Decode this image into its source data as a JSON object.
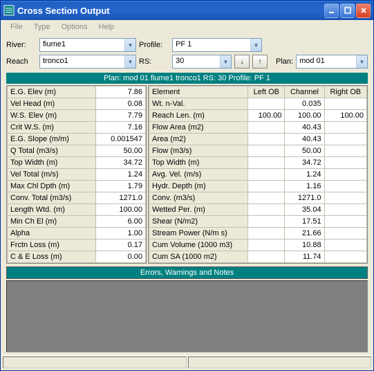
{
  "window": {
    "title": "Cross Section Output"
  },
  "menu": {
    "file": "File",
    "type": "Type",
    "options": "Options",
    "help": "Help"
  },
  "controls": {
    "river_label": "River:",
    "river_value": "fiume1",
    "profile_label": "Profile:",
    "profile_value": "PF 1",
    "reach_label": "Reach",
    "reach_value": "tronco1",
    "rs_label": "RS:",
    "rs_value": "30",
    "plan_label": "Plan:",
    "plan_value": "mod 01"
  },
  "planbar": "Plan: mod 01    fiume1    tronco1   RS: 30    Profile: PF 1",
  "left_rows": [
    {
      "l": "E.G. Elev (m)",
      "v": "7.86"
    },
    {
      "l": "Vel Head (m)",
      "v": "0.08"
    },
    {
      "l": "W.S. Elev (m)",
      "v": "7.79"
    },
    {
      "l": "Crit W.S. (m)",
      "v": "7.16"
    },
    {
      "l": "E.G. Slope (m/m)",
      "v": "0.001547"
    },
    {
      "l": "Q Total (m3/s)",
      "v": "50.00"
    },
    {
      "l": "Top Width (m)",
      "v": "34.72"
    },
    {
      "l": "Vel Total (m/s)",
      "v": "1.24"
    },
    {
      "l": "Max Chl Dpth (m)",
      "v": "1.79"
    },
    {
      "l": "Conv. Total (m3/s)",
      "v": "1271.0"
    },
    {
      "l": "Length Wtd. (m)",
      "v": "100.00"
    },
    {
      "l": "Min Ch El (m)",
      "v": "6.00"
    },
    {
      "l": "Alpha",
      "v": "1.00"
    },
    {
      "l": "Frctn Loss (m)",
      "v": "0.17"
    },
    {
      "l": "C & E Loss (m)",
      "v": "0.00"
    }
  ],
  "right_head": {
    "element": "Element",
    "lob": "Left OB",
    "chan": "Channel",
    "rob": "Right OB"
  },
  "right_rows": [
    {
      "l": "Wt. n-Val.",
      "a": "",
      "b": "0.035",
      "c": ""
    },
    {
      "l": "Reach Len. (m)",
      "a": "100.00",
      "b": "100.00",
      "c": "100.00"
    },
    {
      "l": "Flow Area (m2)",
      "a": "",
      "b": "40.43",
      "c": ""
    },
    {
      "l": "Area (m2)",
      "a": "",
      "b": "40.43",
      "c": ""
    },
    {
      "l": "Flow (m3/s)",
      "a": "",
      "b": "50.00",
      "c": ""
    },
    {
      "l": "Top Width (m)",
      "a": "",
      "b": "34.72",
      "c": ""
    },
    {
      "l": "Avg. Vel. (m/s)",
      "a": "",
      "b": "1.24",
      "c": ""
    },
    {
      "l": "Hydr. Depth (m)",
      "a": "",
      "b": "1.16",
      "c": ""
    },
    {
      "l": "Conv. (m3/s)",
      "a": "",
      "b": "1271.0",
      "c": ""
    },
    {
      "l": "Wetted Per. (m)",
      "a": "",
      "b": "35.04",
      "c": ""
    },
    {
      "l": "Shear (N/m2)",
      "a": "",
      "b": "17.51",
      "c": ""
    },
    {
      "l": "Stream Power (N/m s)",
      "a": "",
      "b": "21.66",
      "c": ""
    },
    {
      "l": "Cum Volume (1000 m3)",
      "a": "",
      "b": "10.88",
      "c": ""
    },
    {
      "l": "Cum SA (1000 m2)",
      "a": "",
      "b": "11.74",
      "c": ""
    }
  ],
  "errbar": "Errors, Warnings and Notes"
}
